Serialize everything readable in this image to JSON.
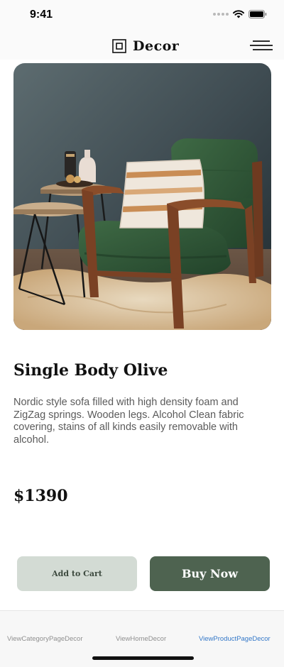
{
  "status_bar": {
    "time": "9:41"
  },
  "header": {
    "title": "Decor",
    "logo_icon": "square-frame-icon",
    "menu_icon": "hamburger-menu-icon"
  },
  "hero": {
    "image": "green-armchair-photo"
  },
  "product": {
    "name": "Single Body Olive",
    "description": "Nordic style sofa filled with high density foam and ZigZag springs. Wooden legs. Alcohol Clean fabric covering, stains of all kinds easily removable with alcohol.",
    "price": "$1390"
  },
  "actions": {
    "add_to_cart": "Add to Cart",
    "buy_now": "Buy Now"
  },
  "bottom_nav": {
    "items": [
      {
        "label": "ViewCategoryPageDecor",
        "active": false
      },
      {
        "label": "ViewHomeDecor",
        "active": false
      },
      {
        "label": "ViewProductPageDecor",
        "active": true
      }
    ]
  },
  "colors": {
    "accent": "#4e6350",
    "secondary_button": "#d3dbd4",
    "active_nav": "#3478c8"
  }
}
